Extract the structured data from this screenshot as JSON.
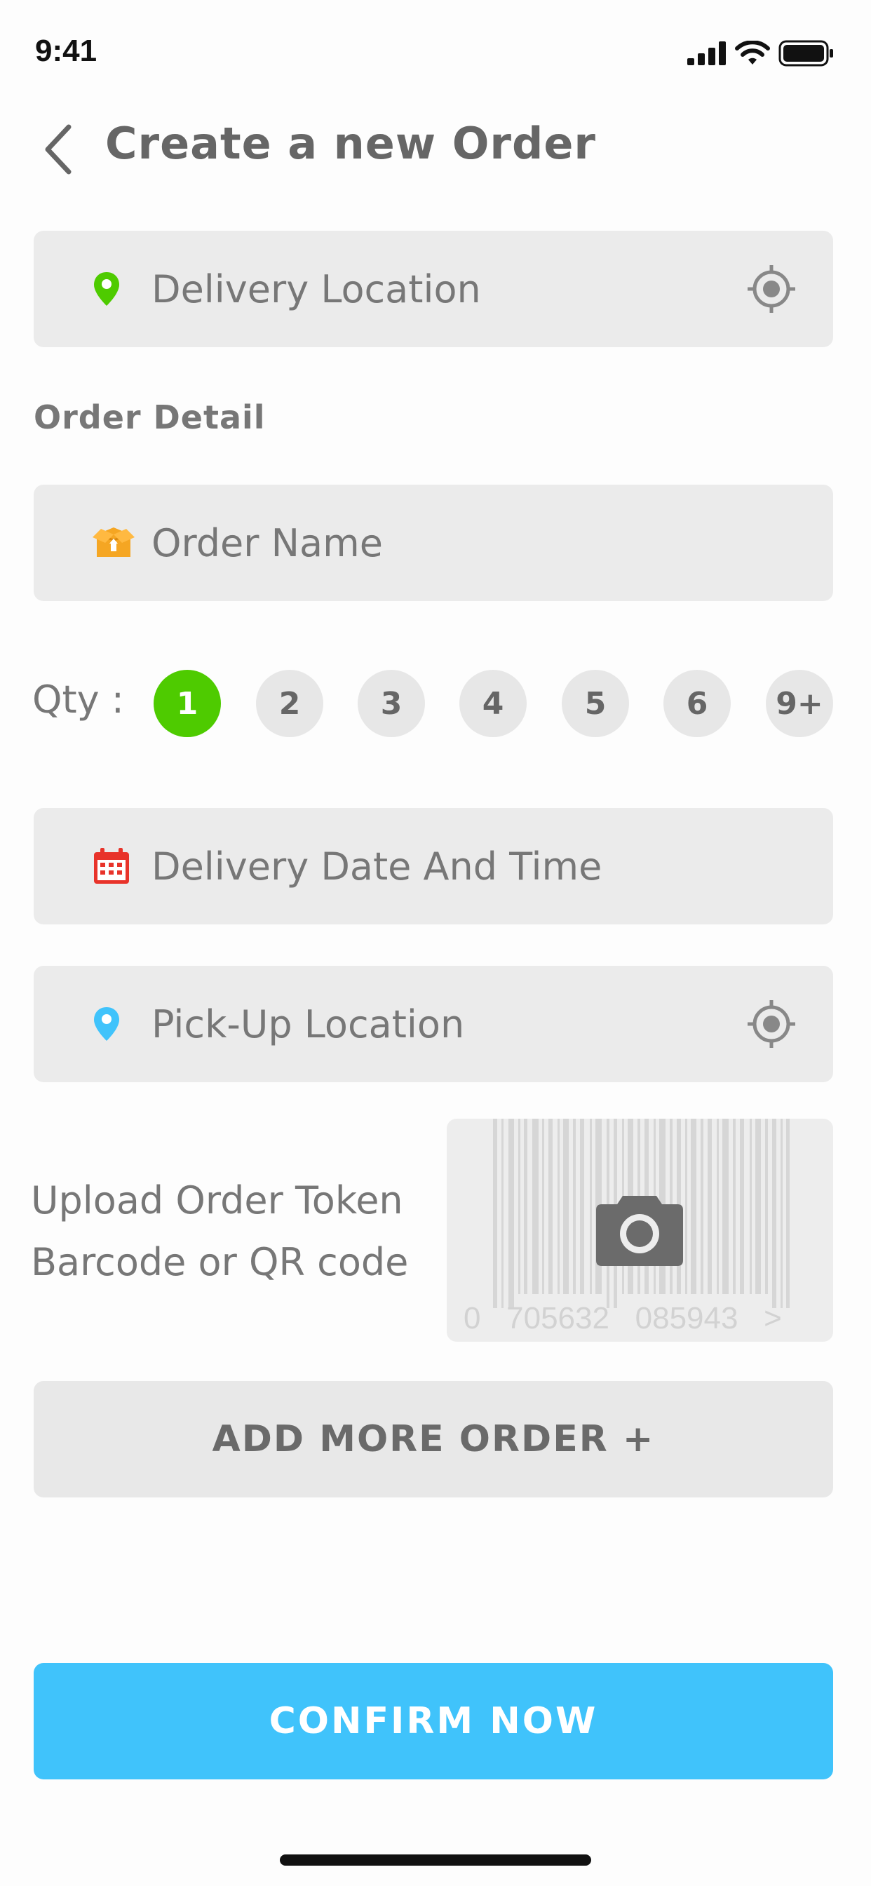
{
  "status_bar": {
    "time": "9:41"
  },
  "header": {
    "title": "Create a new Order"
  },
  "fields": {
    "delivery_location": "Delivery Location",
    "order_name": "Order Name",
    "delivery_datetime": "Delivery Date And Time",
    "pickup_location": "Pick-Up Location"
  },
  "order_detail_title": "Order Detail",
  "qty": {
    "label": "Qty :",
    "options": [
      "1",
      "2",
      "3",
      "4",
      "5",
      "6",
      "9+"
    ],
    "selected": "1"
  },
  "upload": {
    "line1": "Upload Order Token",
    "line2": "Barcode or QR code",
    "barcode_digits": "0   705632   085943   >"
  },
  "buttons": {
    "add_more": "ADD MORE ORDER +",
    "confirm": "CONFIRM NOW"
  },
  "colors": {
    "accent_green": "#4ecb00",
    "confirm_blue": "#40c3fb",
    "field_bg": "#ebebeb",
    "delivery_pin": "#4ecb00",
    "pickup_pin": "#40c3fb",
    "calendar": "#e8332a",
    "box": "#f5a623"
  }
}
